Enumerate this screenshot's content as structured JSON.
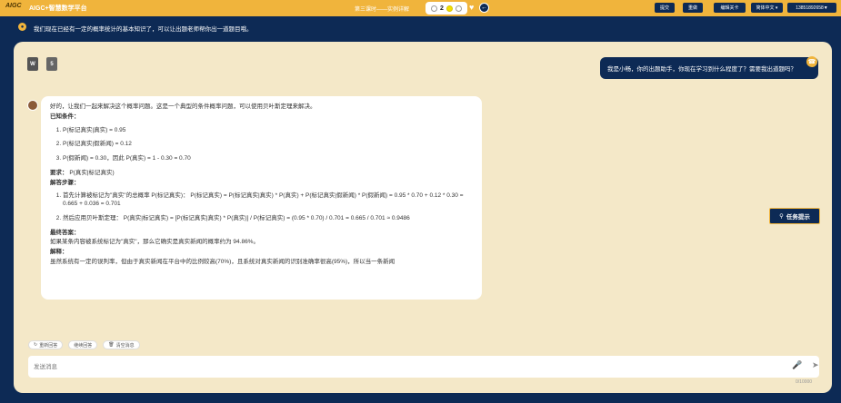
{
  "topbar": {
    "logo": "AIGC",
    "app_title": "AIGC+智慧数学平台",
    "lesson_title": "第三课时——实例详解",
    "page_number": "2",
    "buttons": [
      "提交",
      "重做",
      "编辑关卡",
      "简体中文 ▾",
      "13851892658▼"
    ]
  },
  "notice": {
    "text": "我们现在已经有一定的概率统计的基本知识了，可以让出题老师帮你出一道题目哦。"
  },
  "file_icons": [
    "W",
    "5"
  ],
  "chat": {
    "user_message": "我是小畅，你的出题助手，你现在学习到什么程度了？需要我出道题吗？",
    "ai": {
      "intro": "好的，让我们一起来解决这个概率问题。这是一个典型的条件概率问题，可以使用贝叶斯定理来解决。",
      "known_title": "已知条件：",
      "known_items": [
        "P(标记真实|真实) = 0.95",
        "P(标记真实|假新闻) = 0.12",
        "P(假新闻) = 0.30，因此 P(真实) = 1 - 0.30 = 0.70"
      ],
      "require_label": "要求：",
      "require_value": "P(真实|标记真实)",
      "steps_title": "解答步骤：",
      "steps": [
        "首先计算被标记为\"真实\"的总概率 P(标记真实)：  P(标记真实) = P(标记真实|真实) * P(真实) + P(标记真实|假新闻) * P(假新闻) = 0.95 * 0.70 + 0.12 * 0.30 = 0.665 + 0.036 = 0.701",
        "然后应用贝叶斯定理：  P(真实|标记真实) = [P(标记真实|真实) * P(真实)] / P(标记真实) = (0.95 * 0.70) / 0.701 = 0.665 / 0.701 ≈ 0.9486"
      ],
      "final_title": "最终答案：",
      "final_text": "如果某条内容被系统标记为\"真实\"，那么它确实是真实新闻的概率约为 94.86%。",
      "explain_title": "解释：",
      "explain_text": "虽然系统有一定的误判率，但由于真实新闻在平台中的比例较高(70%)，且系统对真实新闻的识别准确率很高(95%)，所以当一条新闻"
    }
  },
  "task_hint_button": "任务提示",
  "actions": [
    "重新回答",
    "继续回答",
    "清空消息"
  ],
  "input": {
    "placeholder": "发送消息",
    "counter": "0/10000"
  },
  "colors": {
    "accent": "#f0b43c",
    "navy": "#0d2a55",
    "panel": "#f4e8c8"
  }
}
